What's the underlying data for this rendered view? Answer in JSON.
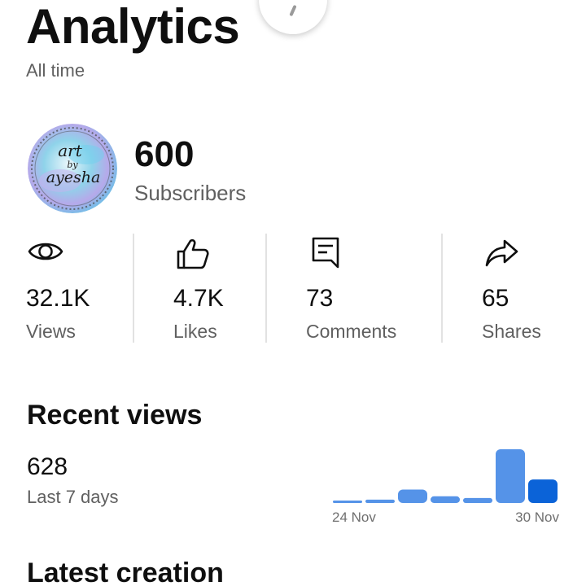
{
  "header": {
    "title": "Analytics",
    "subtitle": "All time"
  },
  "channel": {
    "avatar_text": [
      "art",
      "by",
      "ayesha"
    ],
    "subscribers_value": "600",
    "subscribers_label": "Subscribers"
  },
  "stats": [
    {
      "icon": "eye-icon",
      "value": "32.1K",
      "label": "Views"
    },
    {
      "icon": "thumbs-up-icon",
      "value": "4.7K",
      "label": "Likes"
    },
    {
      "icon": "comment-icon",
      "value": "73",
      "label": "Comments"
    },
    {
      "icon": "share-icon",
      "value": "65",
      "label": "Shares"
    }
  ],
  "recent_views": {
    "title": "Recent views",
    "value": "628",
    "period": "Last 7 days"
  },
  "latest_creation": {
    "title": "Latest creation"
  },
  "colors": {
    "bar": "#5593e8",
    "bar_latest": "#0b63d8",
    "text_secondary": "#606060"
  },
  "chart_data": {
    "type": "bar",
    "categories": [
      "24 Nov",
      "25 Nov",
      "26 Nov",
      "27 Nov",
      "28 Nov",
      "29 Nov",
      "30 Nov"
    ],
    "values": [
      2,
      4,
      16,
      8,
      6,
      64,
      28
    ],
    "x_tick_labels": [
      "24 Nov",
      "30 Nov"
    ],
    "highlight_index": 6,
    "grid": false,
    "title": "",
    "xlabel": "",
    "ylabel": ""
  }
}
